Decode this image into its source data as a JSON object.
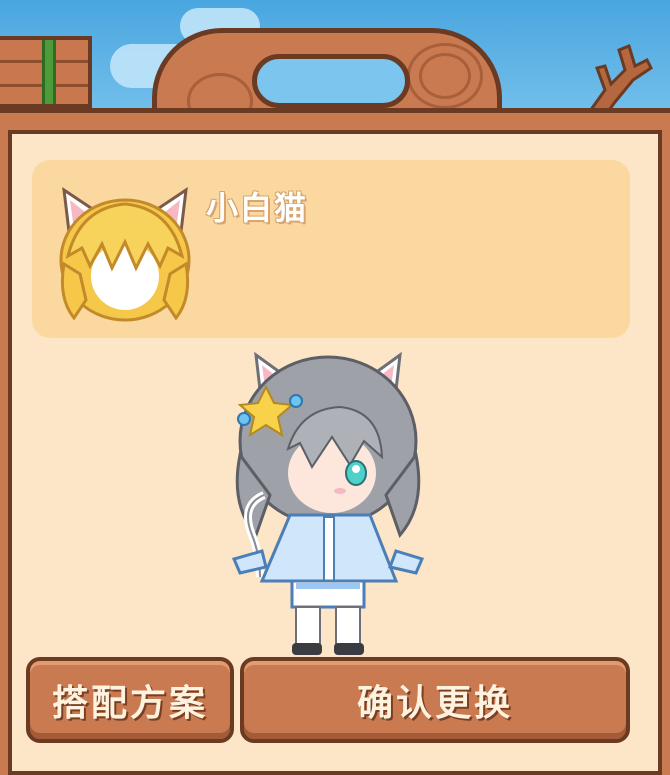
{
  "item": {
    "name": "小白猫",
    "icon": "cat-ear-headband-icon"
  },
  "character": {
    "icon": "chibi-cat-girl-avatar"
  },
  "buttons": {
    "outfit_label": "搭配方案",
    "confirm_label": "确认更换"
  },
  "colors": {
    "wood": "#c97a50",
    "wood_dark": "#6b3a22",
    "panel": "#fde6c7",
    "card": "#fbd8a0",
    "sky": "#5fb4e6"
  }
}
